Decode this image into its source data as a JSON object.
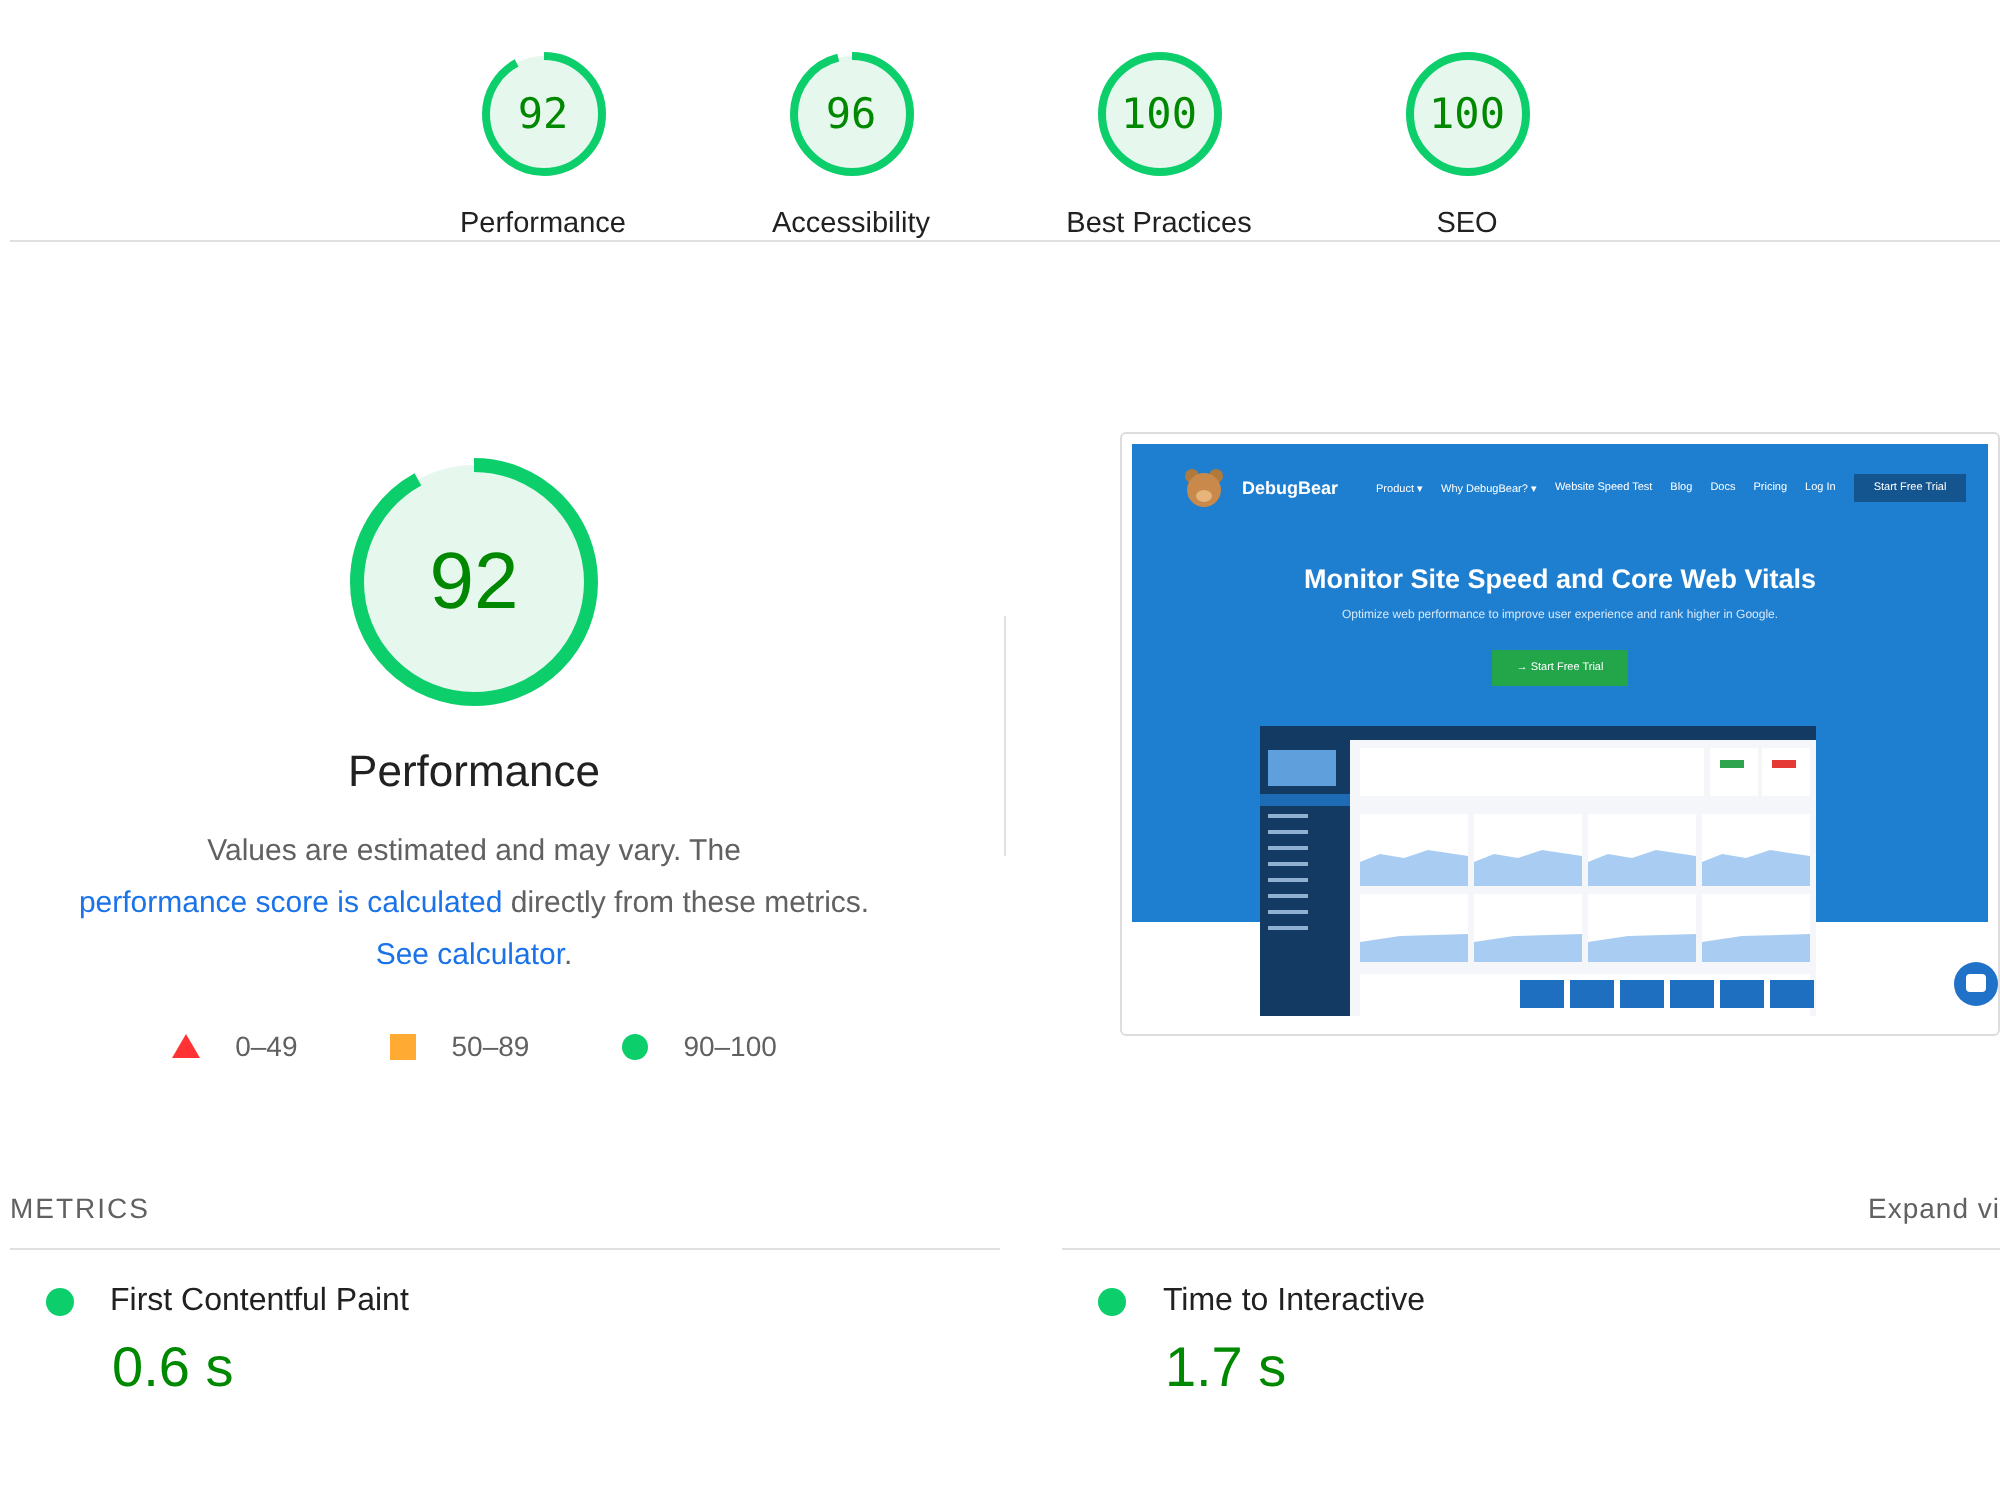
{
  "categories": [
    {
      "label": "Performance",
      "score": "92",
      "level": 0.92
    },
    {
      "label": "Accessibility",
      "score": "96",
      "level": 0.96
    },
    {
      "label": "Best Practices",
      "score": "100",
      "level": 1
    },
    {
      "label": "SEO",
      "score": "100",
      "level": 1
    }
  ],
  "performance": {
    "score": "92",
    "level": 0.92,
    "title": "Performance",
    "description": [
      {
        "kind": "text",
        "text": "Values are estimated and may vary. The "
      },
      {
        "kind": "link",
        "text": "performance score is calculated"
      },
      {
        "kind": "text",
        "text": " directly from these metrics. "
      },
      {
        "kind": "link",
        "text": "See calculator"
      },
      {
        "kind": "text",
        "text": "."
      }
    ],
    "legend": [
      {
        "kind": "fail",
        "label": "0–49"
      },
      {
        "kind": "average",
        "label": "50–89"
      },
      {
        "kind": "pass",
        "label": "90–100"
      }
    ]
  },
  "screenshot": {
    "brand": "DebugBear",
    "nav": [
      "Product ▾",
      "Why DebugBear? ▾",
      "Website Speed Test",
      "Blog",
      "Docs",
      "Pricing",
      "Log In"
    ],
    "nav_button": "Start Free Trial",
    "headline": "Monitor Site Speed and Core Web Vitals",
    "subtitle": "Optimize web performance to improve user experience and rank higher in Google.",
    "cta": "→ Start Free Trial"
  },
  "metrics": {
    "heading": "METRICS",
    "toggle": "Expand vi",
    "items": [
      {
        "label": "First Contentful Paint",
        "value": "0.6 s"
      },
      {
        "label": "Time to Interactive",
        "value": "1.7 s"
      }
    ]
  }
}
